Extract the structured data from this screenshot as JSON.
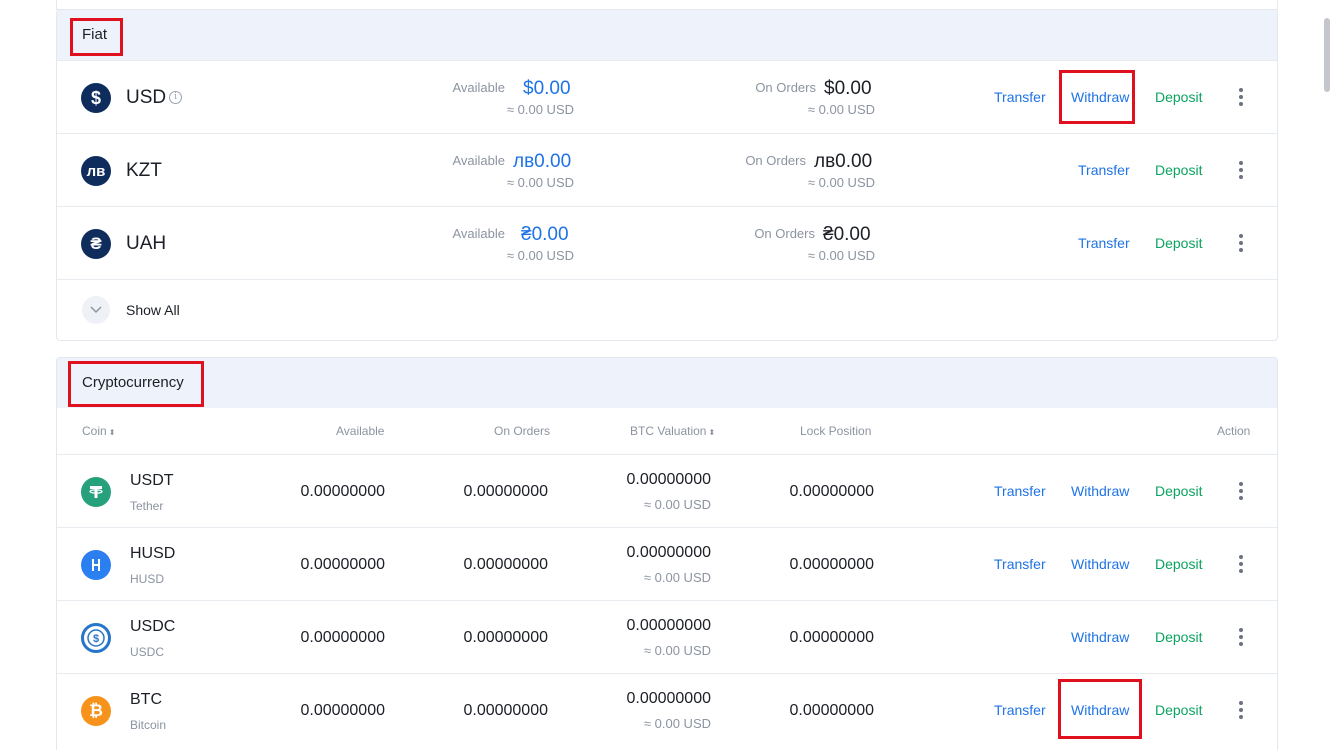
{
  "fiat": {
    "title": "Fiat",
    "rows": [
      {
        "code": "USD",
        "symbol": "$",
        "icon": "dollar-icon",
        "available_label": "Available",
        "available_value": "$0.00",
        "available_usd": "≈ 0.00 USD",
        "on_orders_label": "On Orders",
        "on_orders_value": "$0.00",
        "on_orders_usd": "≈ 0.00 USD",
        "transfer": "Transfer",
        "withdraw": "Withdraw",
        "deposit": "Deposit",
        "info": "i"
      },
      {
        "code": "KZT",
        "symbol": "лв",
        "icon": "tenge-icon",
        "available_label": "Available",
        "available_value": "лв0.00",
        "available_usd": "≈ 0.00 USD",
        "on_orders_label": "On Orders",
        "on_orders_value": "лв0.00",
        "on_orders_usd": "≈ 0.00 USD",
        "transfer": "Transfer",
        "deposit": "Deposit"
      },
      {
        "code": "UAH",
        "symbol": "₴",
        "icon": "hryvnia-icon",
        "available_label": "Available",
        "available_value": "₴0.00",
        "available_usd": "≈ 0.00 USD",
        "on_orders_label": "On Orders",
        "on_orders_value": "₴0.00",
        "on_orders_usd": "≈ 0.00 USD",
        "transfer": "Transfer",
        "deposit": "Deposit"
      }
    ],
    "show_all": "Show All"
  },
  "crypto": {
    "title": "Cryptocurrency",
    "columns": {
      "coin": "Coin",
      "available": "Available",
      "on_orders": "On Orders",
      "btc_valuation": "BTC Valuation",
      "lock_position": "Lock Position",
      "action": "Action"
    },
    "rows": [
      {
        "code": "USDT",
        "name": "Tether",
        "available": "0.00000000",
        "on_orders": "0.00000000",
        "btc_val": "0.00000000",
        "btc_usd": "≈ 0.00 USD",
        "lock": "0.00000000",
        "transfer": "Transfer",
        "withdraw": "Withdraw",
        "deposit": "Deposit",
        "color": "#26a17b"
      },
      {
        "code": "HUSD",
        "name": "HUSD",
        "available": "0.00000000",
        "on_orders": "0.00000000",
        "btc_val": "0.00000000",
        "btc_usd": "≈ 0.00 USD",
        "lock": "0.00000000",
        "transfer": "Transfer",
        "withdraw": "Withdraw",
        "deposit": "Deposit",
        "color": "#2b7ff0"
      },
      {
        "code": "USDC",
        "name": "USDC",
        "available": "0.00000000",
        "on_orders": "0.00000000",
        "btc_val": "0.00000000",
        "btc_usd": "≈ 0.00 USD",
        "lock": "0.00000000",
        "withdraw": "Withdraw",
        "deposit": "Deposit",
        "color": "#2775ca"
      },
      {
        "code": "BTC",
        "name": "Bitcoin",
        "available": "0.00000000",
        "on_orders": "0.00000000",
        "btc_val": "0.00000000",
        "btc_usd": "≈ 0.00 USD",
        "lock": "0.00000000",
        "transfer": "Transfer",
        "withdraw": "Withdraw",
        "deposit": "Deposit",
        "color": "#f7931a"
      }
    ]
  },
  "colors": {
    "accent_blue": "#1e73e6",
    "deposit_green": "#0ba360",
    "highlight_red": "#e0101f",
    "fiat_icon_navy": "#0f2d5c"
  }
}
